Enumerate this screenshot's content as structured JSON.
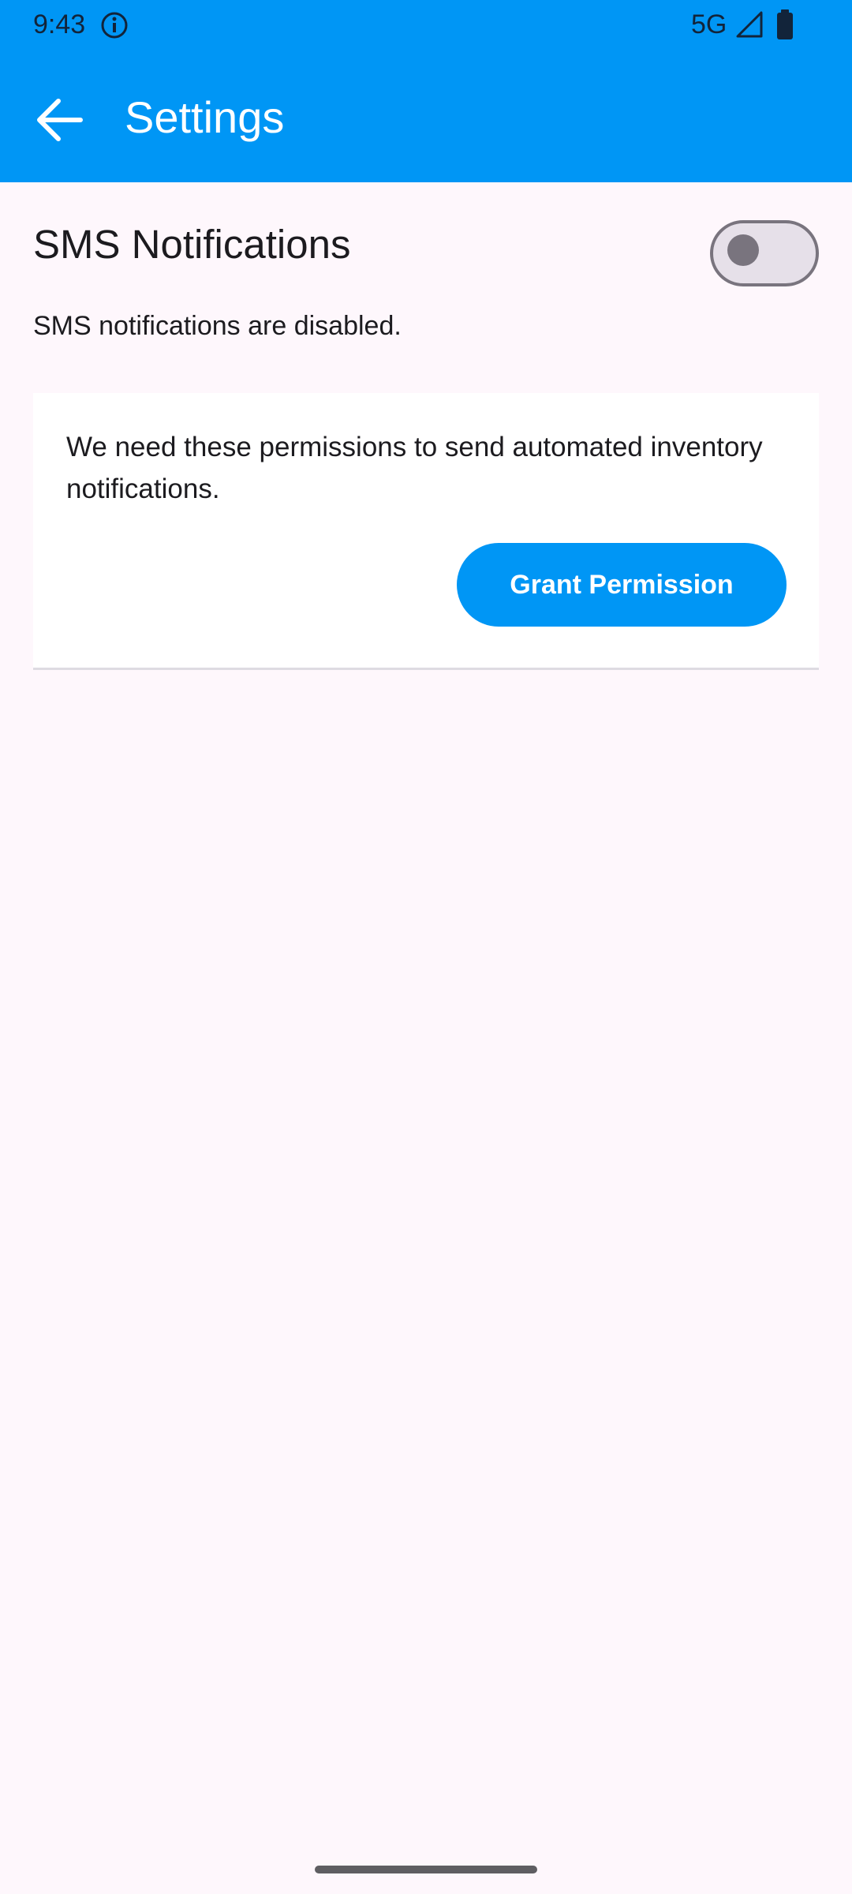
{
  "status_bar": {
    "time": "9:43",
    "network": "5G",
    "info_icon": "info-circle-icon",
    "signal_icon": "signal-icon",
    "battery_icon": "battery-icon"
  },
  "app_bar": {
    "title": "Settings",
    "back_icon": "arrow-left-icon",
    "background_color": "#0096f5"
  },
  "sms_setting": {
    "title": "SMS Notifications",
    "toggle_enabled": false,
    "status_text": "SMS notifications are disabled."
  },
  "permission_card": {
    "message": "We need these permissions to send automated inventory notifications.",
    "button_label": "Grant Permission"
  },
  "colors": {
    "accent": "#0096f5",
    "background": "#fef7fc",
    "text": "#1c1b1f"
  }
}
